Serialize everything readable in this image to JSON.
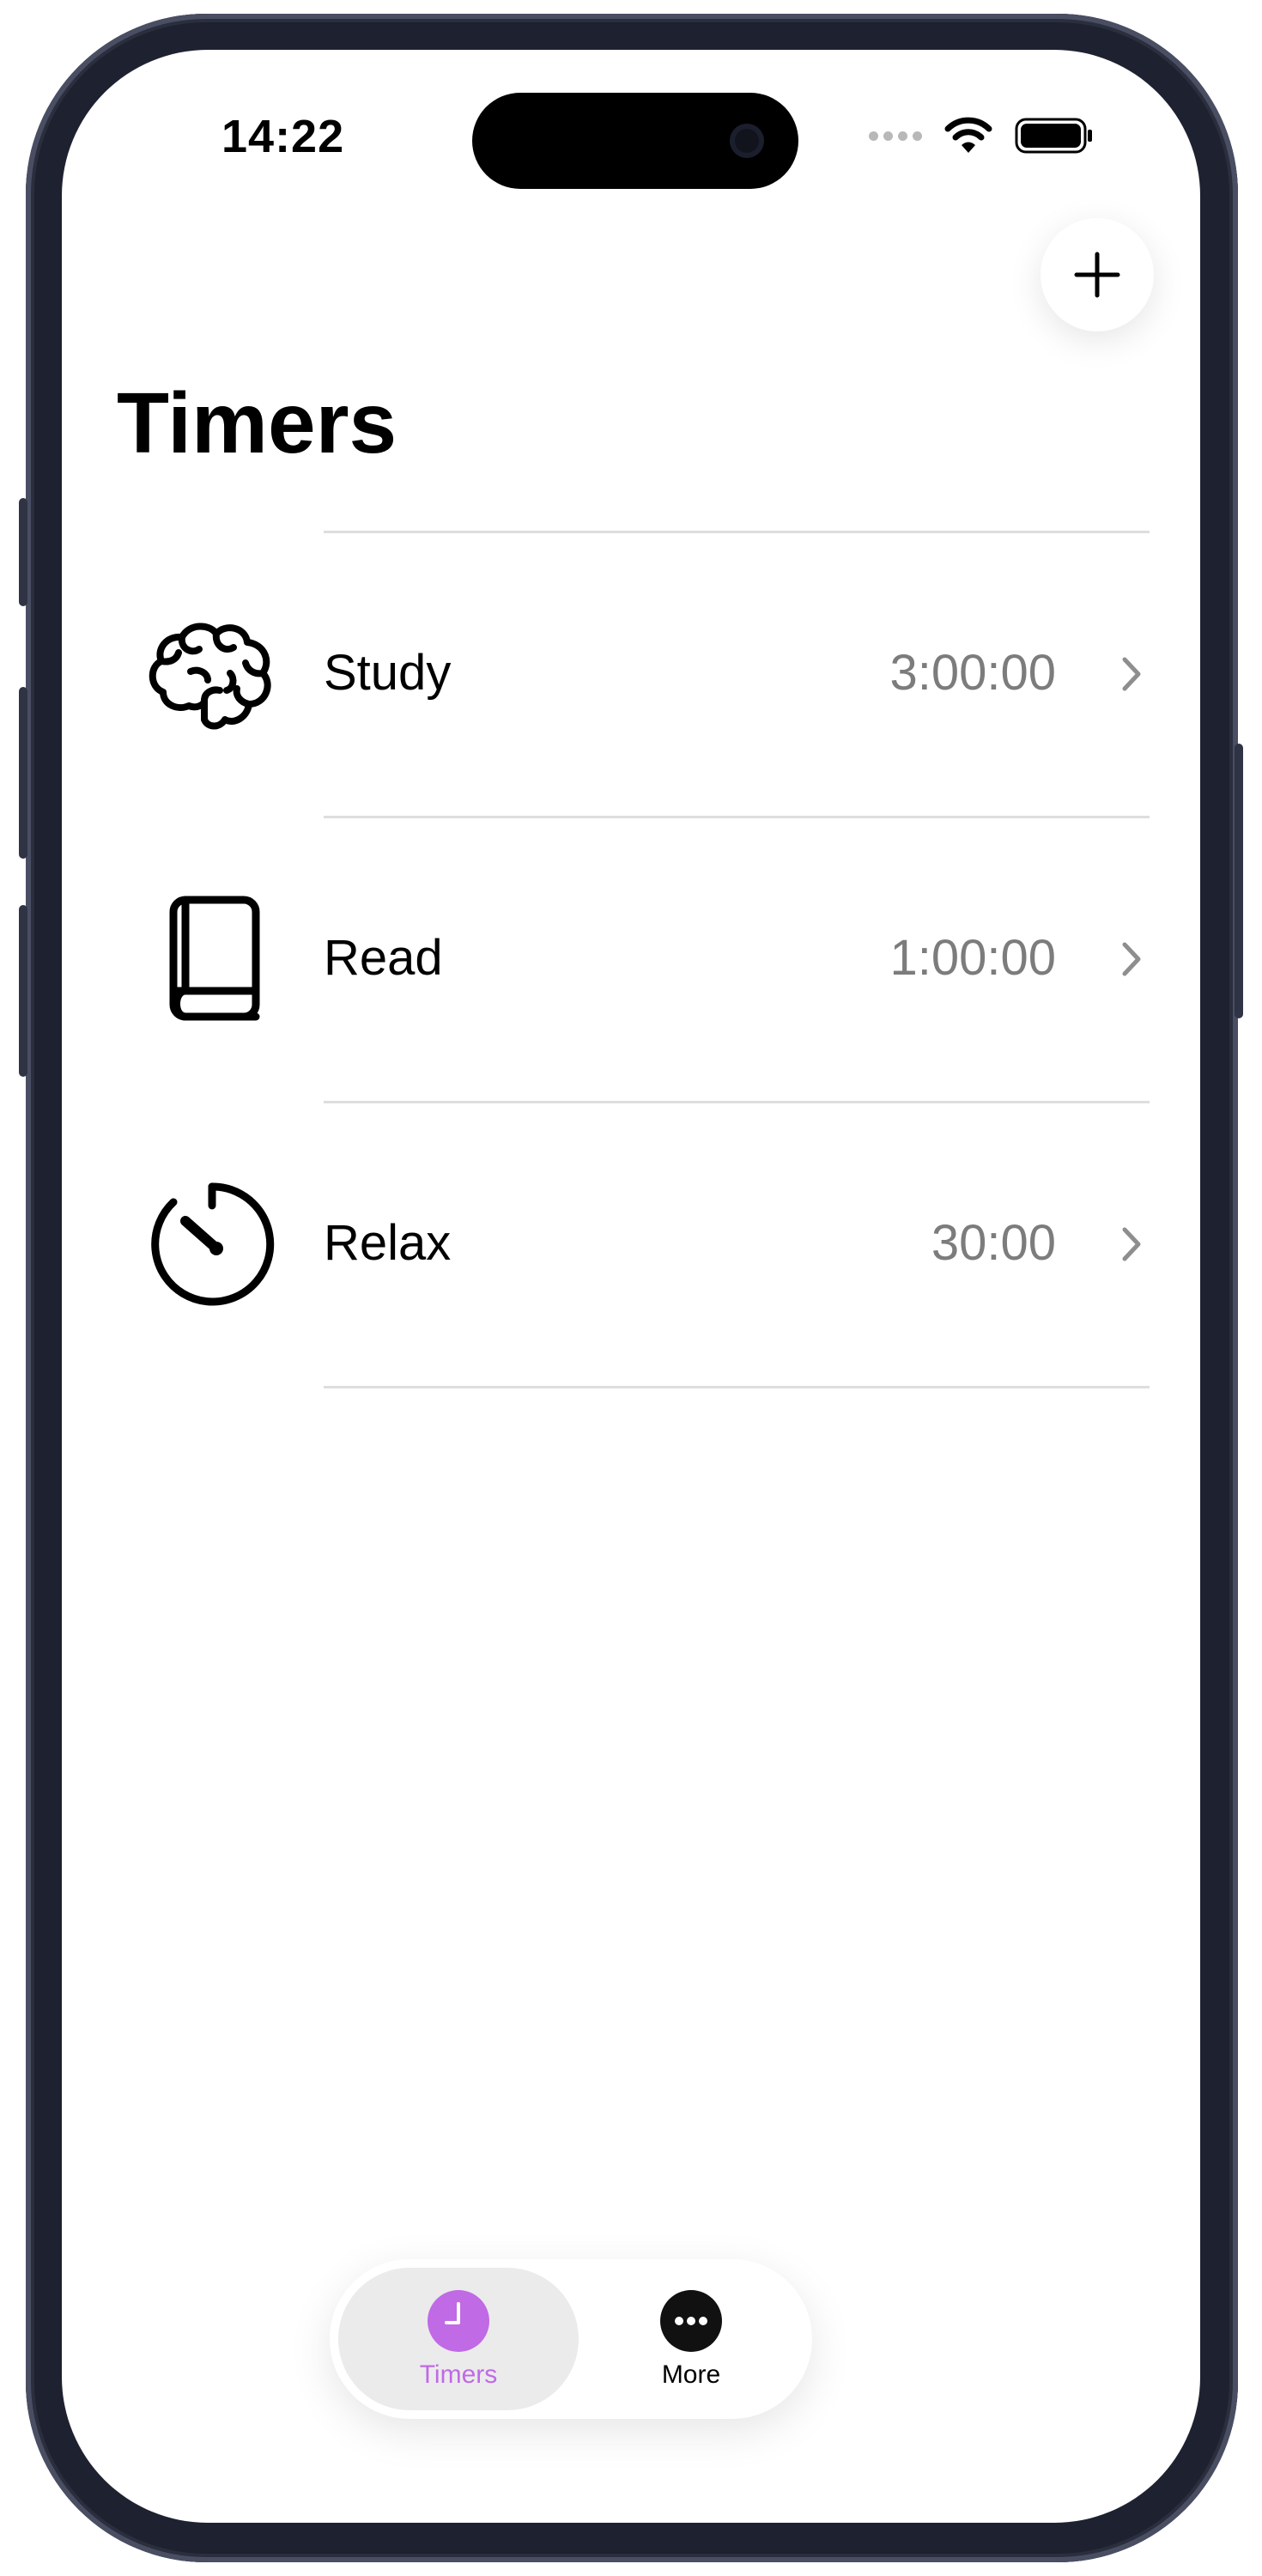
{
  "status_bar": {
    "time": "14:22"
  },
  "header": {
    "title": "Timers",
    "add_icon": "plus-icon"
  },
  "timers": [
    {
      "name": "Study",
      "duration": "3:00:00",
      "icon": "brain-icon"
    },
    {
      "name": "Read",
      "duration": "1:00:00",
      "icon": "book-icon"
    },
    {
      "name": "Relax",
      "duration": "30:00",
      "icon": "timer-icon"
    }
  ],
  "tab_bar": {
    "tabs": [
      {
        "label": "Timers",
        "icon": "clock-icon",
        "selected": true
      },
      {
        "label": "More",
        "icon": "ellipsis-icon",
        "selected": false
      }
    ]
  },
  "colors": {
    "accent": "#c06ae6",
    "secondary_text": "#7c7c7c",
    "divider": "#dedede",
    "selected_tab_bg": "#ebebeb"
  }
}
